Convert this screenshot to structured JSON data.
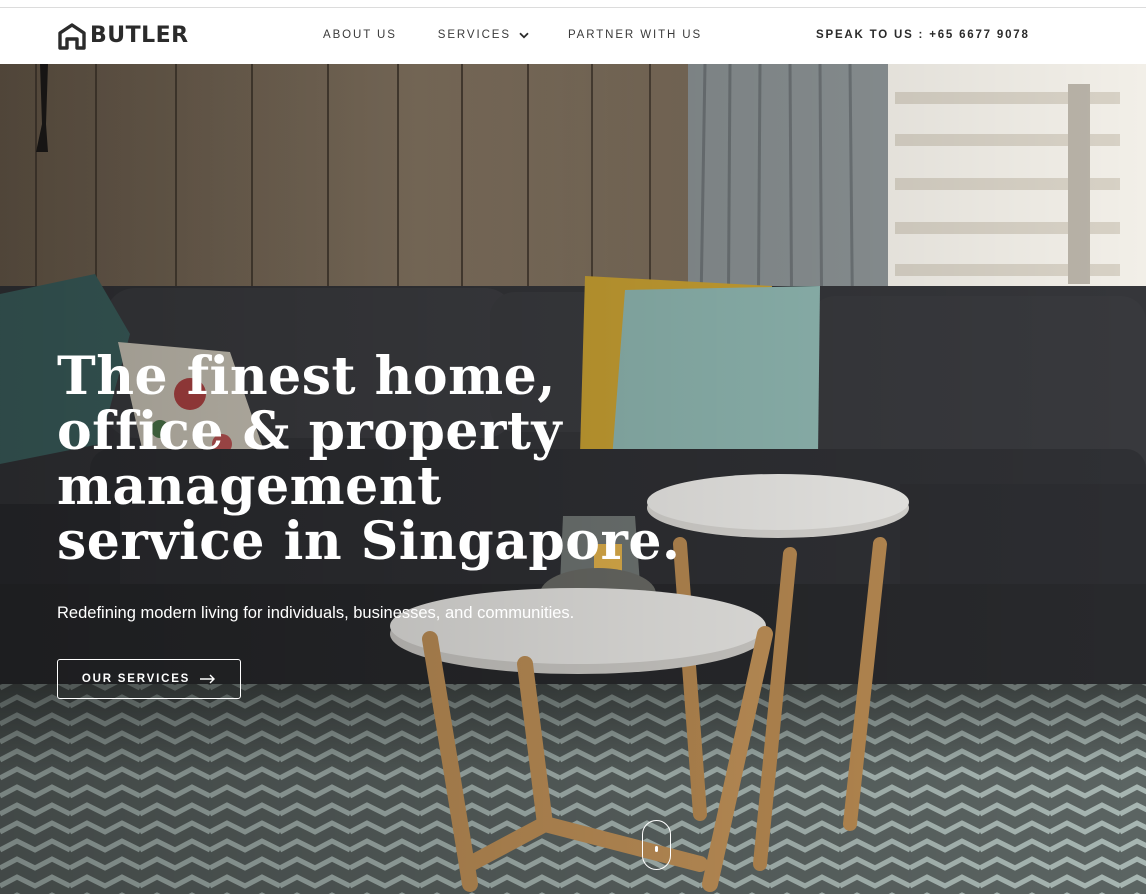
{
  "header": {
    "logo_text": "BUTLER",
    "logo_icon": "house-icon",
    "nav": {
      "about": "ABOUT US",
      "services": "SERVICES",
      "partner": "PARTNER WITH US"
    },
    "contact_label": "SPEAK TO US :",
    "contact_phone": "+65 6677 9078"
  },
  "hero": {
    "headline": [
      "The finest home,",
      "office & property",
      "management",
      "service in Singapore."
    ],
    "subheadline": "Redefining modern living for individuals, businesses, and communities.",
    "cta_label": "OUR SERVICES",
    "cta_icon": "arrow-right-icon",
    "scroll_icon": "mouse-scroll-icon"
  },
  "colors": {
    "header_bg": "#ffffff",
    "text_dark": "#2b2b2b",
    "hero_text": "#ffffff"
  }
}
